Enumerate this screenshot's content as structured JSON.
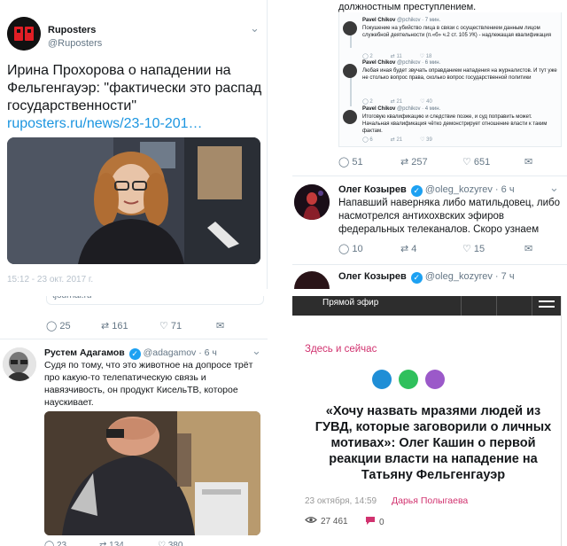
{
  "tweet_ruposters": {
    "name": "Ruposters",
    "handle": "@Ruposters",
    "text": "Ирина Прохорова о нападении на Фельгенгауэр: \"фактически это распад государственности\" ",
    "link": "ruposters.ru/news/23-10-201…",
    "meta_cut": "15:12 - 23 окт. 2017 г."
  },
  "thread": {
    "cut_text": "должностным преступлением.",
    "replies": [
      {
        "name": "Pavel Chikov",
        "handle": "@pchikov · 7 мин.",
        "text": "Покушение на убийство лица в связи с осуществлением данным лицом служебной деятельности (п.«б» ч.2 ст. 105 УК) - надлежащая квалификация",
        "replies": "2",
        "retweets": "11",
        "likes": "18"
      },
      {
        "name": "Pavel Chikov",
        "handle": "@pchikov · 6 мин.",
        "text": "Любая иная будет звучать оправданием нападения на журналистов. И тут уже не столько вопрос права, сколько вопрос государственной политики",
        "replies": "2",
        "retweets": "21",
        "likes": "40"
      },
      {
        "name": "Pavel Chikov",
        "handle": "@pchikov · 4 мин.",
        "text": "Итоговую квалификацию и следствие позже, и суд поправить может. Начальная квалификация чётко демонстрирует отношение власти к таким фактам.",
        "replies": "6",
        "retweets": "21",
        "likes": "39"
      }
    ],
    "replies_count": "51",
    "retweets_count": "257",
    "likes_count": "651"
  },
  "tweet_kozyrev": {
    "name": "Олег Козырев",
    "handle": "@oleg_kozyrev · 6 ч",
    "text": "Напавший наверняка либо матильдовец, либо насмотрелся антихохвских эфиров федеральных телеканалов. Скоро узнаем",
    "replies": "10",
    "retweets": "4",
    "likes": "15"
  },
  "tweet_kozyrev_2": {
    "name": "Олег Козырев",
    "handle": "@oleg_kozyrev · 7 ч"
  },
  "tweet_adagamov": {
    "cut_link": "tjournal.ru",
    "prev_replies": "25",
    "prev_retweets": "161",
    "prev_likes": "71",
    "name": "Рустем Адагамов",
    "handle": "@adagamov · 6 ч",
    "text": "Судя по тому, что это животное на допросе трёт про какую-то телепатическую связь и навязчивость, он продукт КисельТВ, которое наускивает.",
    "replies": "23",
    "retweets": "134",
    "likes": "380"
  },
  "article": {
    "live_label": "Прямой эфир",
    "section": "Здесь и сейчас",
    "headline": "«Хочу назвать мразями людей из ГУВД, которые заговорили о личных мотивах»: Олег Кашин о первой реакции власти на нападение на Татьяну Фельгенгауэр",
    "date": "23 октября, 14:59",
    "author": "Дарья Полыгаева",
    "views": "27 461",
    "comments": "0",
    "dot_colors": [
      "#1f8ed6",
      "#2fc05c",
      "#9b59c9"
    ],
    "accent": "#d1326f"
  }
}
